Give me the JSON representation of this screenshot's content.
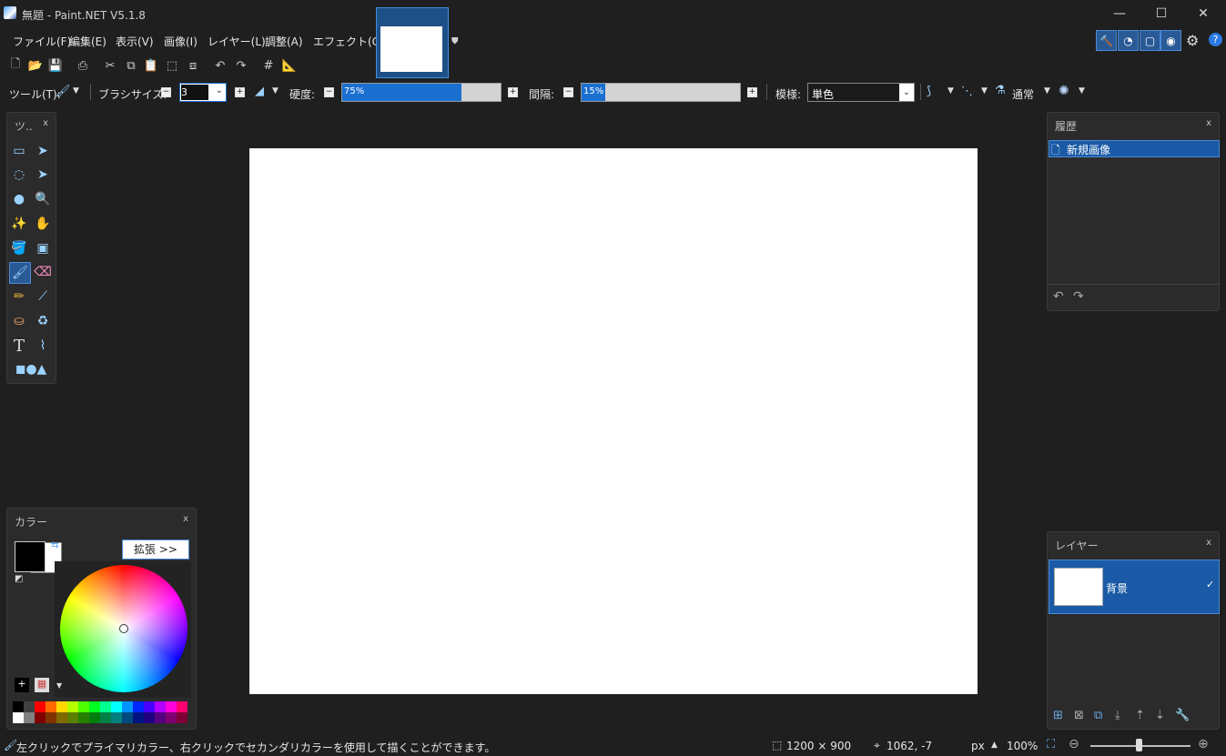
{
  "window": {
    "title": "無題 - Paint.NET V5.1.8",
    "minimize": "—",
    "maximize": "☐",
    "close": "✕"
  },
  "menu": {
    "file": "ファイル(F)",
    "edit": "編集(E)",
    "view": "表示(V)",
    "image": "画像(I)",
    "layer": "レイヤー(L)",
    "adjust": "調整(A)",
    "effect": "エフェクト(C)"
  },
  "toolbar2": {
    "tool_label": "ツール(T):",
    "brush_size_label": "ブラシサイズ:",
    "brush_size_value": "3",
    "hardness_label": "硬度:",
    "hardness_value": "75%",
    "hardness_fraction": 0.75,
    "spacing_label": "間隔:",
    "spacing_value": "15%",
    "spacing_fraction": 0.15,
    "pattern_label": "模様:",
    "pattern_value": "単色",
    "blend_mode": "通常"
  },
  "tools_panel": {
    "title": "ツ..",
    "close": "x"
  },
  "history_panel": {
    "title": "履歴",
    "close": "x",
    "items": [
      {
        "label": "新規画像"
      }
    ]
  },
  "colors_panel": {
    "title": "カラー",
    "close": "x",
    "expand_button": "拡張 >>",
    "primary_color": "#000000",
    "secondary_color": "#ffffff"
  },
  "layers_panel": {
    "title": "レイヤー",
    "close": "x",
    "layers": [
      {
        "name": "背景",
        "visible": true
      }
    ]
  },
  "status": {
    "hint": "左クリックでプライマリカラー、右クリックでセカンダリカラーを使用して描くことができます。",
    "image_size": "1200 × 900",
    "cursor_pos": "1062, -7",
    "unit": "px",
    "zoom": "100%"
  },
  "palette": {
    "top_row": [
      "#000000",
      "#404040",
      "#ff0000",
      "#ff6a00",
      "#ffd800",
      "#b6ff00",
      "#4cff00",
      "#00ff21",
      "#00ff90",
      "#00ffff",
      "#0094ff",
      "#0026ff",
      "#4800ff",
      "#b200ff",
      "#ff00dc",
      "#ff006e"
    ],
    "bottom_row": [
      "#ffffff",
      "#808080",
      "#7f0000",
      "#7f3300",
      "#7f6a00",
      "#5b7f00",
      "#267f00",
      "#007f0e",
      "#007f46",
      "#007f7f",
      "#004a7f",
      "#00137f",
      "#21007f",
      "#57007f",
      "#7f006e",
      "#7f0037"
    ]
  }
}
